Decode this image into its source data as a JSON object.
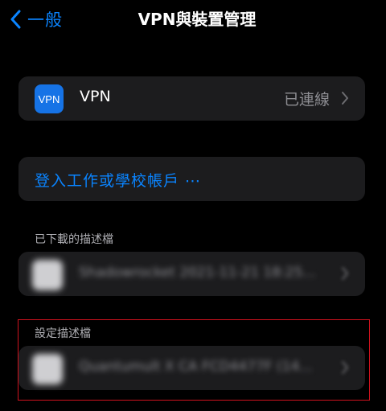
{
  "nav": {
    "back_label": "一般",
    "title": "VPN與裝置管理"
  },
  "vpn": {
    "badge": "VPN",
    "label": "VPN",
    "status": "已連線"
  },
  "login": {
    "label": "登入工作或學校帳戶 ⋯"
  },
  "downloaded": {
    "header": "已下載的描述檔",
    "item_text": "Shadowrocket 2021-11-21 18:25..."
  },
  "configured": {
    "header": "設定描述檔",
    "item_text": "Quantumult X CA FCD4477F (14..."
  },
  "colors": {
    "accent": "#0a84ff",
    "highlight": "#d0121e",
    "vpn_badge": "#1673e6"
  }
}
